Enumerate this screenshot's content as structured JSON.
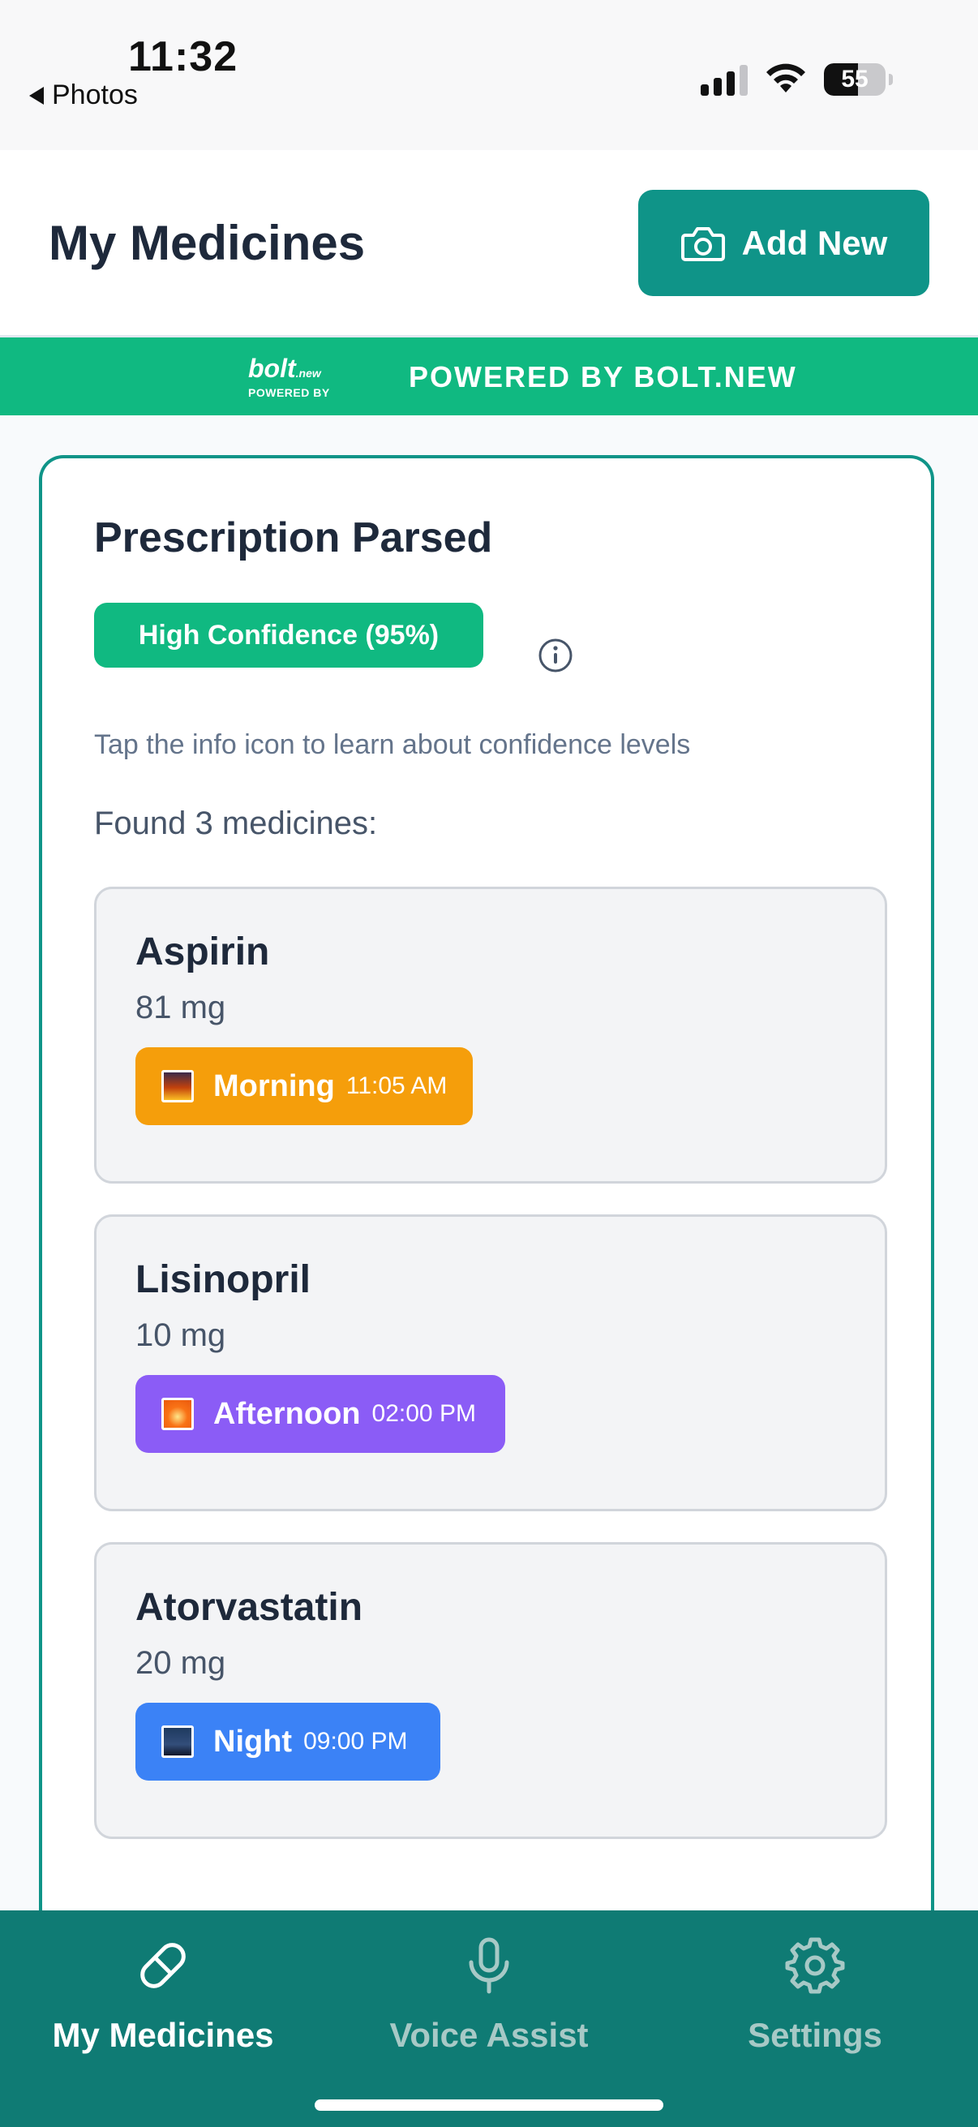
{
  "status_bar": {
    "time": "11:32",
    "back_label": "Photos",
    "battery": "55",
    "battery_level": 0.55
  },
  "header": {
    "title": "My Medicines",
    "add_button": "Add New"
  },
  "banner": {
    "logo_word": "bolt",
    "logo_suffix": ".new",
    "logo_sub": "POWERED BY",
    "text": "POWERED BY BOLT.NEW"
  },
  "card": {
    "title": "Prescription Parsed",
    "confidence": "High Confidence (95%)",
    "hint": "Tap the info icon to learn about confidence levels",
    "found": "Found 3 medicines:",
    "medicines": [
      {
        "name": "Aspirin",
        "dose": "81 mg",
        "slot": "Morning",
        "time": "11:05 AM",
        "color": "#f59e0b",
        "icon": "sunrise-icon"
      },
      {
        "name": "Lisinopril",
        "dose": "10 mg",
        "slot": "Afternoon",
        "time": "02:00 PM",
        "color": "#8b5cf6",
        "icon": "sun-icon"
      },
      {
        "name": "Atorvastatin",
        "dose": "20 mg",
        "slot": "Night",
        "time": "09:00 PM",
        "color": "#3b82f6",
        "icon": "night-city-icon"
      }
    ]
  },
  "nav": {
    "items": [
      {
        "label": "My Medicines",
        "icon": "pill-icon",
        "active": true
      },
      {
        "label": "Voice Assist",
        "icon": "microphone-icon",
        "active": false
      },
      {
        "label": "Settings",
        "icon": "gear-icon",
        "active": false
      }
    ]
  },
  "colors": {
    "teal": "#0f9488",
    "green": "#10b981",
    "nav_bg": "#0f7b74"
  }
}
